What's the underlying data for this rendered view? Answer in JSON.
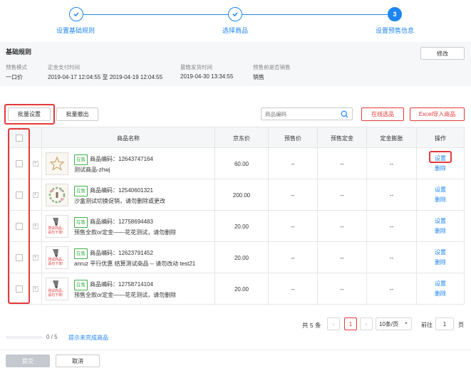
{
  "steps": [
    {
      "label": "设置基础规则",
      "state": "done"
    },
    {
      "label": "选择商品",
      "state": "done"
    },
    {
      "label": "设置预售信息",
      "number": "3",
      "state": "active"
    }
  ],
  "rules": {
    "title": "基础规则",
    "edit_label": "修改",
    "fields": [
      {
        "label": "预售模式",
        "value": "一口价"
      },
      {
        "label": "定金支付时间",
        "value": "2019-04-17 12:04:55 至 2019-04-19 12:04:55"
      },
      {
        "label": "最晚发货时间",
        "value": "2019-04-30 13:34:55"
      },
      {
        "label": "预售前是否销售",
        "value": "销售"
      }
    ]
  },
  "toolbar": {
    "batch_set": "批量设置",
    "batch_remove": "批量撤出",
    "search_placeholder": "商品编码",
    "online_select": "在线选品",
    "excel_import": "Excel导入商品"
  },
  "table": {
    "columns": [
      "商品名称",
      "京东价",
      "预售价",
      "预售定金",
      "定金膨胀",
      "操作"
    ],
    "rows": [
      {
        "tag": "在售",
        "code": "商品编码：12643747164",
        "name": "测试商品-zhwj",
        "price": "60.00",
        "presale_price": "--",
        "deposit": "--",
        "expand": "--",
        "set": "设置",
        "delete": "删除",
        "thumb": "star"
      },
      {
        "tag": "在售",
        "code": "商品编码：12540601321",
        "name": "沙盒测试切换促销，请勿删除或更改",
        "price": "200.00",
        "presale_price": "--",
        "deposit": "--",
        "expand": "--",
        "set": "设置",
        "delete": "删除",
        "thumb": "wreath"
      },
      {
        "tag": "在售",
        "code": "商品编码：12758694483",
        "name": "预售全款or定金——花花测试，请勿删除",
        "price": "20.00",
        "presale_price": "--",
        "deposit": "--",
        "expand": "--",
        "set": "设置",
        "delete": "删除",
        "thumb": "test",
        "thumb_text1": "测试商品，",
        "thumb_text2": "请勿下单!"
      },
      {
        "tag": "在售",
        "code": "商品编码：12623791452",
        "name": "anruz 平行优惠 结算测试商品 -- 请勿改动 test21",
        "price": "20.00",
        "presale_price": "--",
        "deposit": "--",
        "expand": "--",
        "set": "设置",
        "delete": "删除",
        "thumb": "test",
        "thumb_text1": "测试商品，",
        "thumb_text2": "请勿下单!"
      },
      {
        "tag": "在售",
        "code": "商品编码：12758714104",
        "name": "预售全款or定金——花花测试，请勿删除",
        "price": "20.00",
        "presale_price": "--",
        "deposit": "--",
        "expand": "--",
        "set": "设置",
        "delete": "删除",
        "thumb": "test",
        "thumb_text1": "测试商品，",
        "thumb_text2": "请勿下单!"
      }
    ]
  },
  "pagination": {
    "total": "共 5 条",
    "current": "1",
    "page_size": "10条/页",
    "goto_label": "前往",
    "goto_value": "1",
    "page_suffix": "页"
  },
  "progress": {
    "text": "0 / 5",
    "fraction": 0,
    "link": "提示未完成商品"
  },
  "footer": {
    "submit": "提交",
    "cancel": "取消"
  },
  "colors": {
    "accent": "#1f86f1",
    "highlight": "#e4393c",
    "tag_green": "#3fae49"
  }
}
